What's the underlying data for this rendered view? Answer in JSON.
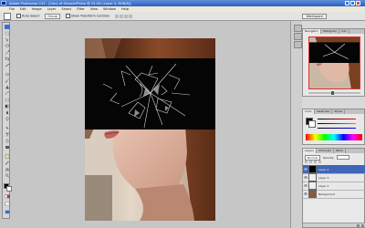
{
  "window": {
    "title": "Adobe Photoshop CS2 - [Copy of GlassedPhoto @ 25.4% (Layer 4, RGB/8)]"
  },
  "menu": [
    "File",
    "Edit",
    "Image",
    "Layer",
    "Select",
    "Filter",
    "View",
    "Window",
    "Help"
  ],
  "options": {
    "auto_select_label": "Auto Select",
    "auto_select_value": "Group",
    "transform_label": "Show Transform Controls",
    "workspace_label": "Workspace"
  },
  "panels": {
    "navigator_tabs": [
      "Navigator",
      "Histogram",
      "Info"
    ],
    "color_tabs": [
      "Color",
      "Swatches",
      "Styles"
    ],
    "layers_tabs": [
      "Layers",
      "Channels",
      "Paths"
    ],
    "layers_blend": "Normal",
    "layers_opacity_label": "Opacity:",
    "layers": [
      {
        "name": "Layer 4",
        "selected": true
      },
      {
        "name": "Layer 3",
        "selected": false
      },
      {
        "name": "Layer 2",
        "selected": false
      },
      {
        "name": "Background",
        "selected": false
      }
    ]
  },
  "colors": {
    "title_bar": "#2c5fc4",
    "selection": "#3f66b8",
    "canvas_bg": "#c6c6c6"
  },
  "icons": [
    "photoshop-logo-icon",
    "minimize-icon",
    "maximize-icon",
    "close-icon",
    "eye-icon"
  ]
}
